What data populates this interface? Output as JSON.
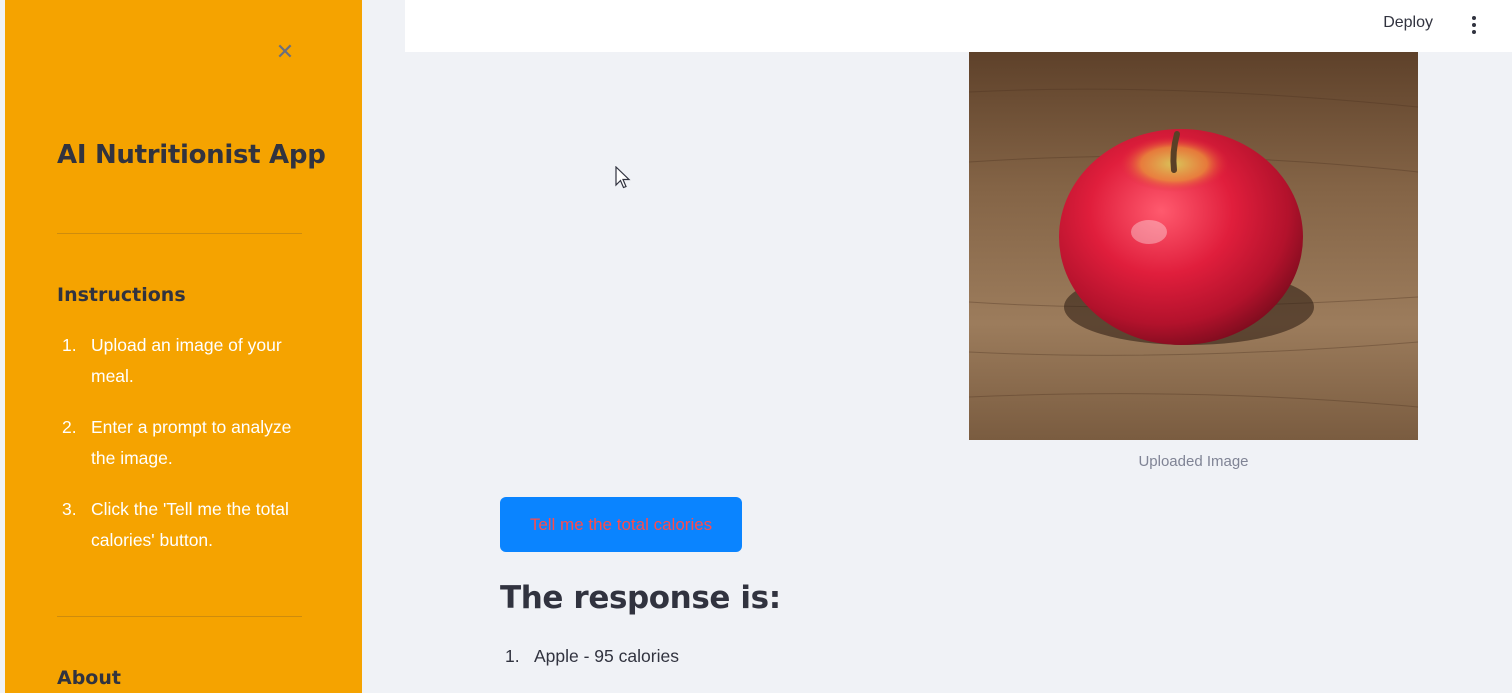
{
  "sidebar": {
    "close_icon": "close-icon",
    "title": "AI Nutritionist App",
    "instructions_heading": "Instructions",
    "steps": [
      {
        "num": "1.",
        "text": "Upload an image of your meal."
      },
      {
        "num": "2.",
        "text": "Enter a prompt to analyze the image."
      },
      {
        "num": "3.",
        "text": "Click the 'Tell me the total calories' button."
      }
    ],
    "about_heading": "About"
  },
  "header": {
    "deploy_label": "Deploy",
    "menu_icon": "more-vertical-icon"
  },
  "main": {
    "image_caption": "Uploaded Image",
    "image_subject": "red apple on wooden table",
    "button_label": "Tell me the total calories",
    "response_heading": "The response is:",
    "response_items": [
      {
        "num": "1.",
        "text": "Apple - 95 calories"
      }
    ]
  },
  "colors": {
    "sidebar_bg": "#f5a300",
    "main_bg": "#f0f2f6",
    "button_bg": "#0a84ff",
    "button_text": "#ff4b4b"
  }
}
